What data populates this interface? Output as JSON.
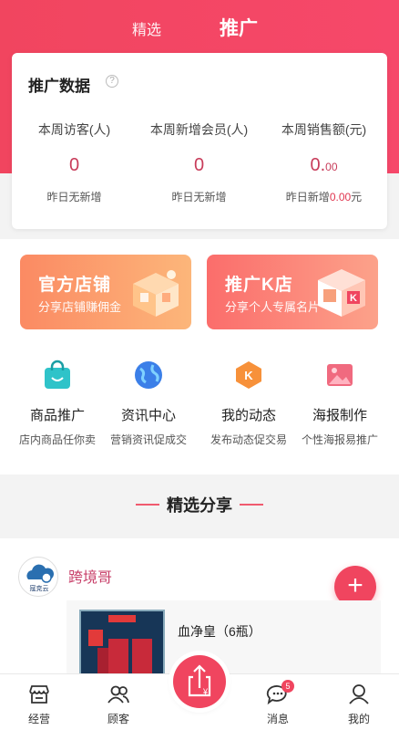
{
  "nav": {
    "tab_featured": "精选",
    "tab_promotion": "推广"
  },
  "stats": {
    "title": "推广数据",
    "help_icon": "?",
    "items": [
      {
        "label": "本周访客(人)",
        "value": "0",
        "sub": "昨日无新增"
      },
      {
        "label": "本周新增会员(人)",
        "value": "0",
        "sub": "昨日无新增"
      },
      {
        "label": "本周销售额(元)",
        "value_main": "0.",
        "value_frac": "00",
        "sub_prefix": "昨日新增",
        "sub_amount": "0.00",
        "sub_suffix": "元"
      }
    ]
  },
  "banners": [
    {
      "title": "官方店铺",
      "subtitle": "分享店铺赚佣金",
      "icon": "store-building-icon"
    },
    {
      "title": "推广K店",
      "subtitle": "分享个人专属名片",
      "icon": "k-store-icon"
    }
  ],
  "menu": [
    {
      "label": "商品推广",
      "desc": "店内商品任你卖",
      "icon": "shopping-bag-icon",
      "color": "#2fc3c9"
    },
    {
      "label": "资讯中心",
      "desc": "营销资讯促成交",
      "icon": "globe-icon",
      "color": "#3b7fe8"
    },
    {
      "label": "我的动态",
      "desc": "发布动态促交易",
      "icon": "k-hexagon-icon",
      "color": "#f7913a"
    },
    {
      "label": "海报制作",
      "desc": "个性海报易推广",
      "icon": "poster-icon",
      "color": "#f06a7f"
    }
  ],
  "section": {
    "title": "精选分享"
  },
  "feed": {
    "user": "跨境哥",
    "avatar_text": "寇克云",
    "product_name": "血净皇（6瓶）"
  },
  "tabbar": [
    {
      "label": "经营",
      "icon": "store-icon"
    },
    {
      "label": "顾客",
      "icon": "customers-icon"
    },
    {
      "label": "消息",
      "icon": "message-icon",
      "badge": "5"
    },
    {
      "label": "我的",
      "icon": "profile-icon"
    }
  ],
  "colors": {
    "primary": "#f0455f",
    "accent_text": "#c83c5a"
  }
}
